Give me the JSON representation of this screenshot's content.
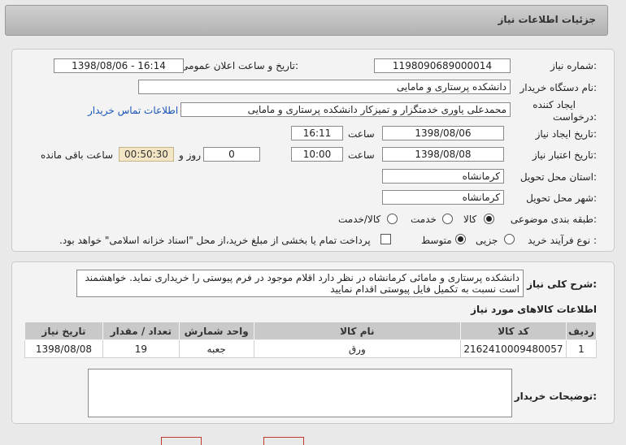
{
  "header": {
    "title": "جزئیات اطلاعات نیاز"
  },
  "form": {
    "need_number_label": "شماره نیاز:",
    "need_number": "1198090689000014",
    "announce_label": "تاریخ و ساعت اعلان عمومی:",
    "announce_value": "1398/08/06 - 16:14",
    "buyer_org_label": "نام دستگاه خریدار:",
    "buyer_org": "دانشکده پرستاری و مامایی",
    "creator_label_1": "ایجاد کننده",
    "creator_label_2": "درخواست:",
    "creator": "محمدعلی یاوری خدمتگزار و تمیزکار دانشکده پرستاری و مامایی",
    "contact_link": "اطلاعات تماس خریدار",
    "created_date_label": "تاریخ ایجاد نیاز:",
    "created_date": "1398/08/06",
    "time_label": "ساعت",
    "created_time": "16:11",
    "validity_label": "تاریخ اعتبار نیاز:",
    "validity_date": "1398/08/08",
    "validity_time": "10:00",
    "days_label": "روز و",
    "days_value": "0",
    "timer_value": "00:50:30",
    "remaining_label": "ساعت باقی مانده",
    "province_label": "استان محل تحویل:",
    "province": "کرمانشاه",
    "city_label": "شهر محل تحویل:",
    "city": "کرمانشاه",
    "category_label": "طبقه بندی موضوعی:",
    "category_options": [
      "کالا",
      "خدمت",
      "کالا/خدمت"
    ],
    "category_selected": "کالا",
    "process_label": "نوع فرآیند خرید :",
    "process_options": [
      "جزیی",
      "متوسط"
    ],
    "process_selected": "متوسط",
    "payment_text": "پرداخت تمام یا بخشی از مبلغ خرید،از محل \"اسناد خزانه اسلامی\" خواهد بود."
  },
  "summary": {
    "label": "شرح کلی نیاز:",
    "text": "دانشکده پرستاری و مامائی کرمانشاه در نظر دارد اقلام موجود در فرم پیوستی را خریداری نماید. خواهشمند است نسبت به تکمیل فایل پیوستی اقدام نمایید"
  },
  "items": {
    "section_title": "اطلاعات کالاهای مورد نیاز",
    "columns": [
      "ردیف",
      "کد کالا",
      "نام کالا",
      "واحد شمارش",
      "تعداد / مقدار",
      "تاریخ نیاز"
    ],
    "rows": [
      [
        "1",
        "2162410009480057",
        "ورق",
        "جعبه",
        "19",
        "1398/08/08"
      ]
    ]
  },
  "buyer_notes": {
    "label": "توضیحات خریدار:",
    "text": ""
  },
  "colors": {
    "header_bg": "#bdbdbd",
    "panel_bg": "#f3f3f3",
    "link": "#1a55b8",
    "timer_bg": "#f3e6c4"
  }
}
